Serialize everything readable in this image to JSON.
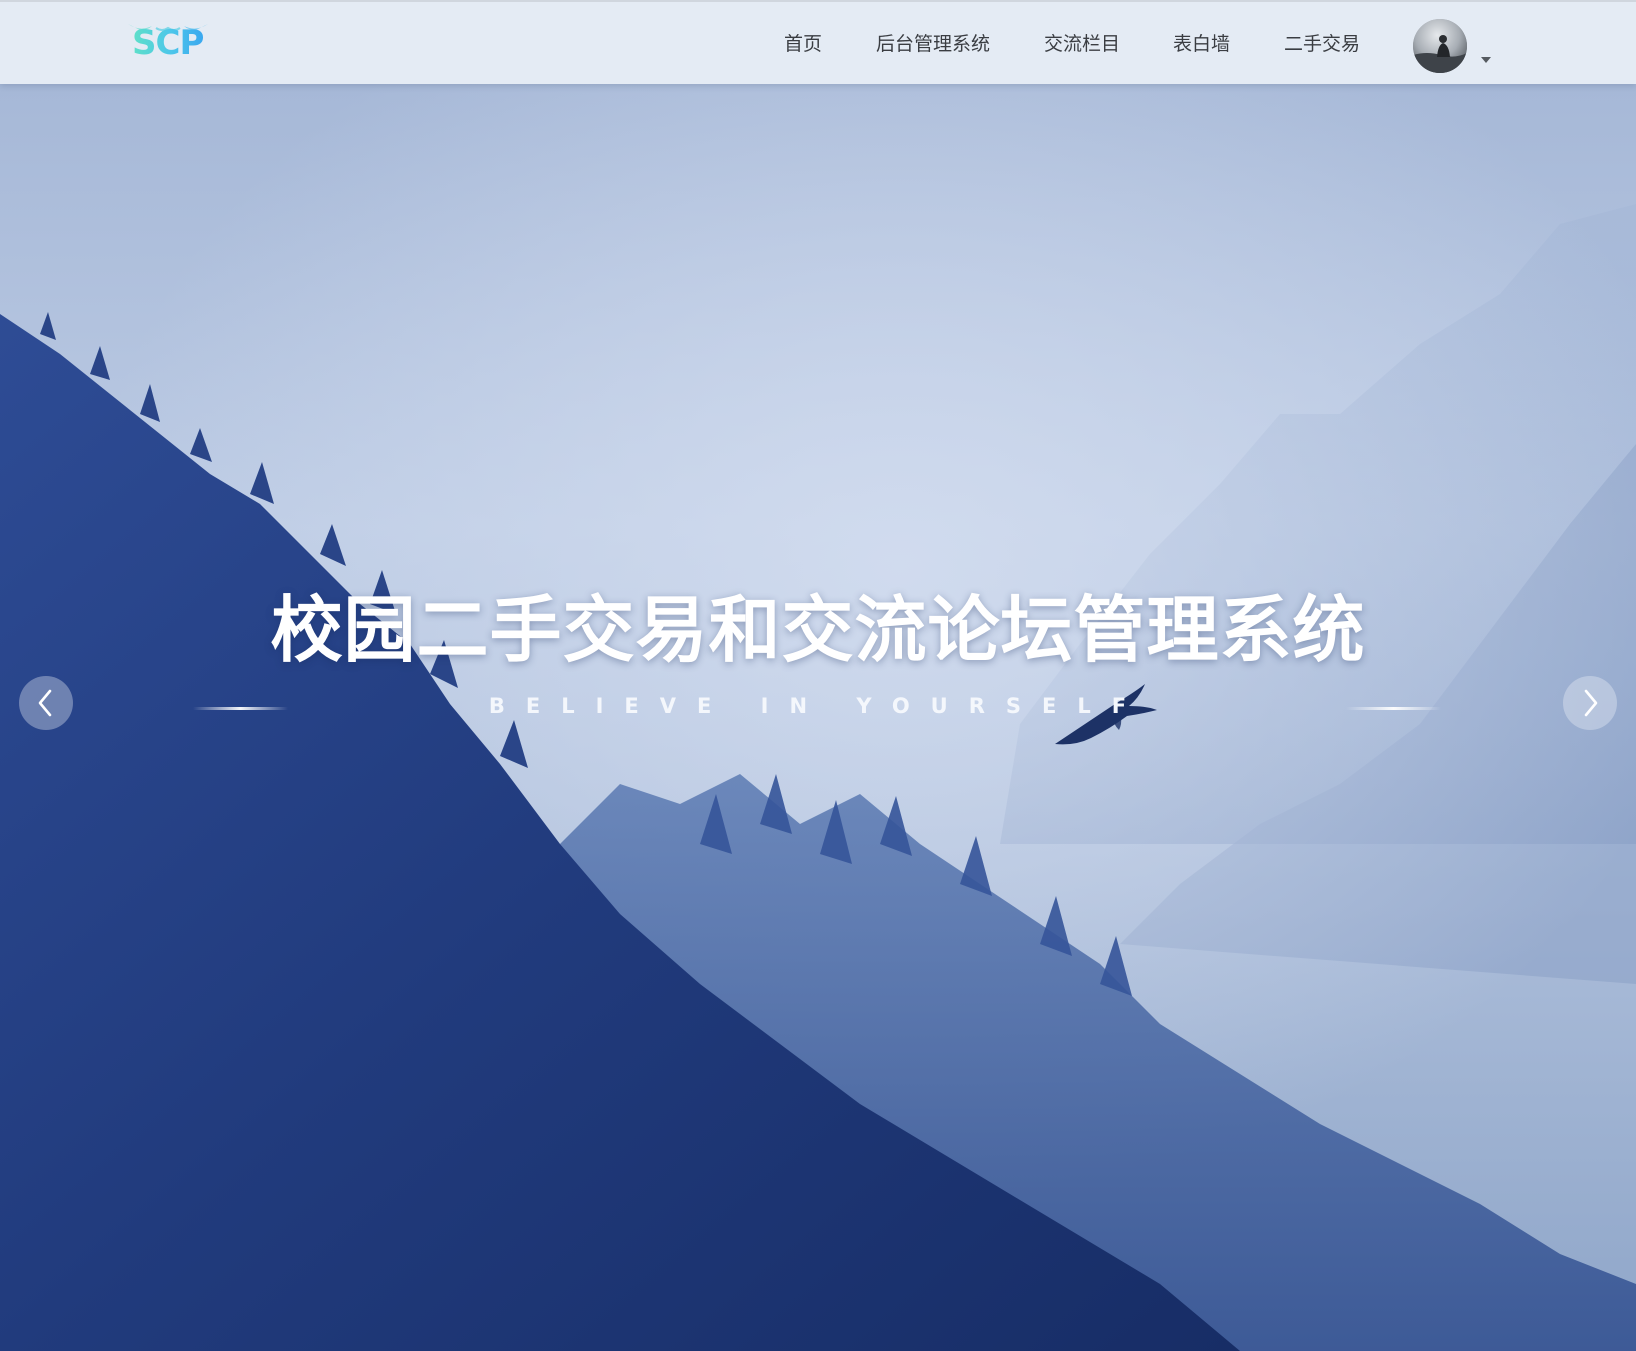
{
  "header": {
    "logo_text": "SCP",
    "nav": {
      "home": "首页",
      "admin": "后台管理系统",
      "forum": "交流栏目",
      "wall": "表白墙",
      "trade": "二手交易"
    }
  },
  "hero": {
    "title": "校园二手交易和交流论坛管理系统",
    "subtitle": "BELIEVE IN YOURSELF"
  },
  "colors": {
    "header_bg": "#e4ebf4",
    "logo_gradient_start": "#5ee0c8",
    "logo_gradient_end": "#3aa8ef",
    "hero_sky": "#bccae3",
    "hero_forest": "#1d3470"
  },
  "icons": {
    "prev": "chevron-left-icon",
    "next": "chevron-right-icon",
    "caret": "caret-down-icon"
  }
}
